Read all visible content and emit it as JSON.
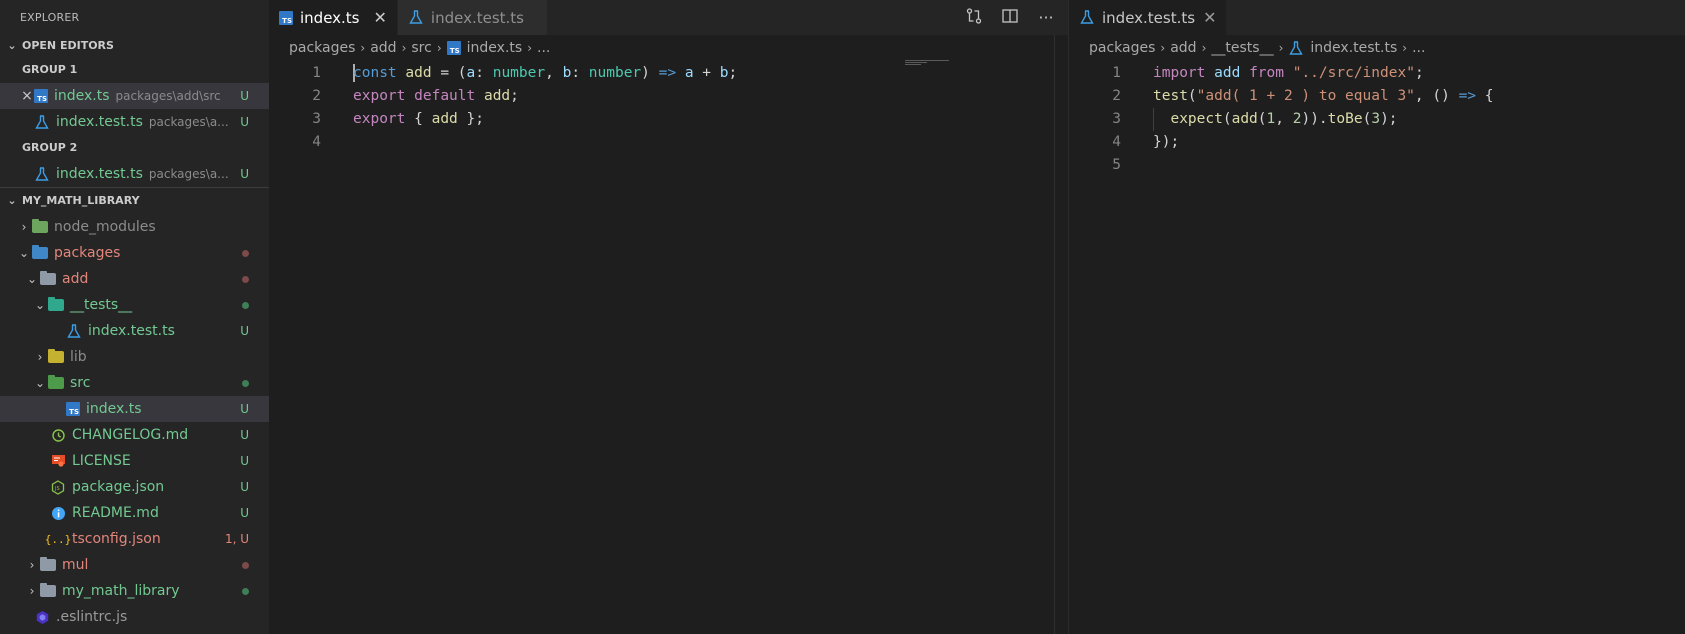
{
  "explorer": {
    "title": "EXPLORER",
    "open_editors_label": "OPEN EDITORS",
    "group1_label": "GROUP 1",
    "group2_label": "GROUP 2",
    "open_editors": [
      {
        "name": "index.ts",
        "path": "packages\\add\\src",
        "badge": "U"
      },
      {
        "name": "index.test.ts",
        "path": "packages\\a...",
        "badge": "U"
      },
      {
        "name": "index.test.ts",
        "path": "packages\\a...",
        "badge": "U"
      }
    ],
    "project_label": "MY_MATH_LIBRARY",
    "tree": [
      {
        "label": "node_modules"
      },
      {
        "label": "packages"
      },
      {
        "label": "add"
      },
      {
        "label": "__tests__"
      },
      {
        "label": "index.test.ts",
        "badge": "U"
      },
      {
        "label": "lib"
      },
      {
        "label": "src"
      },
      {
        "label": "index.ts",
        "badge": "U"
      },
      {
        "label": "CHANGELOG.md",
        "badge": "U"
      },
      {
        "label": "LICENSE",
        "badge": "U"
      },
      {
        "label": "package.json",
        "badge": "U"
      },
      {
        "label": "README.md",
        "badge": "U"
      },
      {
        "label": "tsconfig.json",
        "badge": "1, U"
      },
      {
        "label": "mul"
      },
      {
        "label": "my_math_library"
      },
      {
        "label": ".eslintrc.js"
      }
    ]
  },
  "left_editor": {
    "tabs": [
      {
        "label": "index.ts"
      },
      {
        "label": "index.test.ts"
      }
    ],
    "close_glyph": "✕",
    "breadcrumb": [
      "packages",
      "add",
      "src",
      "index.ts",
      "..."
    ],
    "line_numbers": [
      "1",
      "2",
      "3",
      "4"
    ],
    "code": {
      "l1": [
        "const",
        " add ",
        "=",
        " (",
        "a",
        ": ",
        "number",
        ", ",
        "b",
        ": ",
        "number",
        ") ",
        "=>",
        " ",
        "a",
        " + ",
        "b",
        ";"
      ],
      "l2": [
        "export",
        " ",
        "default",
        " ",
        "add",
        ";"
      ],
      "l3": [
        "export",
        " { ",
        "add",
        " };"
      ]
    }
  },
  "right_editor": {
    "tab": {
      "label": "index.test.ts"
    },
    "close_glyph": "✕",
    "breadcrumb": [
      "packages",
      "add",
      "__tests__",
      "index.test.ts",
      "..."
    ],
    "line_numbers": [
      "1",
      "2",
      "3",
      "4",
      "5"
    ],
    "code": {
      "l1": [
        "import",
        " ",
        "add",
        " ",
        "from",
        " ",
        "\"../src/index\"",
        ";"
      ],
      "l2": [
        "test",
        "(",
        "\"add( 1 + 2 ) to equal 3\"",
        ", () ",
        "=>",
        " {"
      ],
      "l3": [
        "  ",
        "expect",
        "(",
        "add",
        "(",
        "1",
        ", ",
        "2",
        ")).",
        "toBe",
        "(",
        "3",
        ");"
      ],
      "l4": [
        "});"
      ]
    }
  },
  "colors": {
    "sidebar_bg": "#252526",
    "editor_bg": "#1e1e1e",
    "untracked_green": "#73c991",
    "modified_red": "#e2867a",
    "ts_blue": "#3178c6"
  }
}
